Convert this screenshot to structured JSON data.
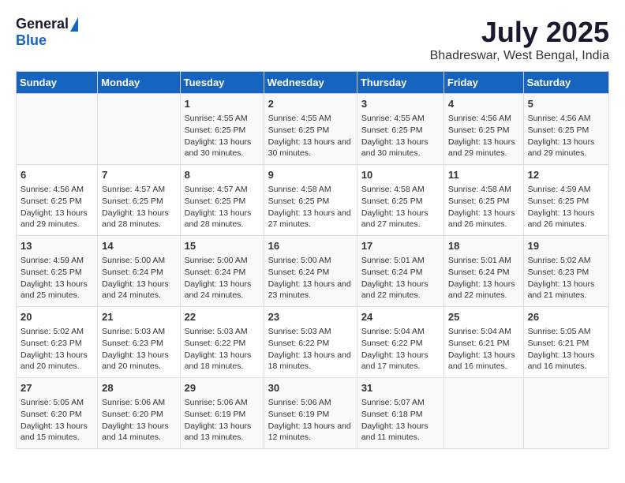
{
  "logo": {
    "general": "General",
    "blue": "Blue"
  },
  "title": "July 2025",
  "subtitle": "Bhadreswar, West Bengal, India",
  "headers": [
    "Sunday",
    "Monday",
    "Tuesday",
    "Wednesday",
    "Thursday",
    "Friday",
    "Saturday"
  ],
  "weeks": [
    [
      {
        "day": "",
        "info": ""
      },
      {
        "day": "",
        "info": ""
      },
      {
        "day": "1",
        "info": "Sunrise: 4:55 AM\nSunset: 6:25 PM\nDaylight: 13 hours and 30 minutes."
      },
      {
        "day": "2",
        "info": "Sunrise: 4:55 AM\nSunset: 6:25 PM\nDaylight: 13 hours and 30 minutes."
      },
      {
        "day": "3",
        "info": "Sunrise: 4:55 AM\nSunset: 6:25 PM\nDaylight: 13 hours and 30 minutes."
      },
      {
        "day": "4",
        "info": "Sunrise: 4:56 AM\nSunset: 6:25 PM\nDaylight: 13 hours and 29 minutes."
      },
      {
        "day": "5",
        "info": "Sunrise: 4:56 AM\nSunset: 6:25 PM\nDaylight: 13 hours and 29 minutes."
      }
    ],
    [
      {
        "day": "6",
        "info": "Sunrise: 4:56 AM\nSunset: 6:25 PM\nDaylight: 13 hours and 29 minutes."
      },
      {
        "day": "7",
        "info": "Sunrise: 4:57 AM\nSunset: 6:25 PM\nDaylight: 13 hours and 28 minutes."
      },
      {
        "day": "8",
        "info": "Sunrise: 4:57 AM\nSunset: 6:25 PM\nDaylight: 13 hours and 28 minutes."
      },
      {
        "day": "9",
        "info": "Sunrise: 4:58 AM\nSunset: 6:25 PM\nDaylight: 13 hours and 27 minutes."
      },
      {
        "day": "10",
        "info": "Sunrise: 4:58 AM\nSunset: 6:25 PM\nDaylight: 13 hours and 27 minutes."
      },
      {
        "day": "11",
        "info": "Sunrise: 4:58 AM\nSunset: 6:25 PM\nDaylight: 13 hours and 26 minutes."
      },
      {
        "day": "12",
        "info": "Sunrise: 4:59 AM\nSunset: 6:25 PM\nDaylight: 13 hours and 26 minutes."
      }
    ],
    [
      {
        "day": "13",
        "info": "Sunrise: 4:59 AM\nSunset: 6:25 PM\nDaylight: 13 hours and 25 minutes."
      },
      {
        "day": "14",
        "info": "Sunrise: 5:00 AM\nSunset: 6:24 PM\nDaylight: 13 hours and 24 minutes."
      },
      {
        "day": "15",
        "info": "Sunrise: 5:00 AM\nSunset: 6:24 PM\nDaylight: 13 hours and 24 minutes."
      },
      {
        "day": "16",
        "info": "Sunrise: 5:00 AM\nSunset: 6:24 PM\nDaylight: 13 hours and 23 minutes."
      },
      {
        "day": "17",
        "info": "Sunrise: 5:01 AM\nSunset: 6:24 PM\nDaylight: 13 hours and 22 minutes."
      },
      {
        "day": "18",
        "info": "Sunrise: 5:01 AM\nSunset: 6:24 PM\nDaylight: 13 hours and 22 minutes."
      },
      {
        "day": "19",
        "info": "Sunrise: 5:02 AM\nSunset: 6:23 PM\nDaylight: 13 hours and 21 minutes."
      }
    ],
    [
      {
        "day": "20",
        "info": "Sunrise: 5:02 AM\nSunset: 6:23 PM\nDaylight: 13 hours and 20 minutes."
      },
      {
        "day": "21",
        "info": "Sunrise: 5:03 AM\nSunset: 6:23 PM\nDaylight: 13 hours and 20 minutes."
      },
      {
        "day": "22",
        "info": "Sunrise: 5:03 AM\nSunset: 6:22 PM\nDaylight: 13 hours and 18 minutes."
      },
      {
        "day": "23",
        "info": "Sunrise: 5:03 AM\nSunset: 6:22 PM\nDaylight: 13 hours and 18 minutes."
      },
      {
        "day": "24",
        "info": "Sunrise: 5:04 AM\nSunset: 6:22 PM\nDaylight: 13 hours and 17 minutes."
      },
      {
        "day": "25",
        "info": "Sunrise: 5:04 AM\nSunset: 6:21 PM\nDaylight: 13 hours and 16 minutes."
      },
      {
        "day": "26",
        "info": "Sunrise: 5:05 AM\nSunset: 6:21 PM\nDaylight: 13 hours and 16 minutes."
      }
    ],
    [
      {
        "day": "27",
        "info": "Sunrise: 5:05 AM\nSunset: 6:20 PM\nDaylight: 13 hours and 15 minutes."
      },
      {
        "day": "28",
        "info": "Sunrise: 5:06 AM\nSunset: 6:20 PM\nDaylight: 13 hours and 14 minutes."
      },
      {
        "day": "29",
        "info": "Sunrise: 5:06 AM\nSunset: 6:19 PM\nDaylight: 13 hours and 13 minutes."
      },
      {
        "day": "30",
        "info": "Sunrise: 5:06 AM\nSunset: 6:19 PM\nDaylight: 13 hours and 12 minutes."
      },
      {
        "day": "31",
        "info": "Sunrise: 5:07 AM\nSunset: 6:18 PM\nDaylight: 13 hours and 11 minutes."
      },
      {
        "day": "",
        "info": ""
      },
      {
        "day": "",
        "info": ""
      }
    ]
  ]
}
